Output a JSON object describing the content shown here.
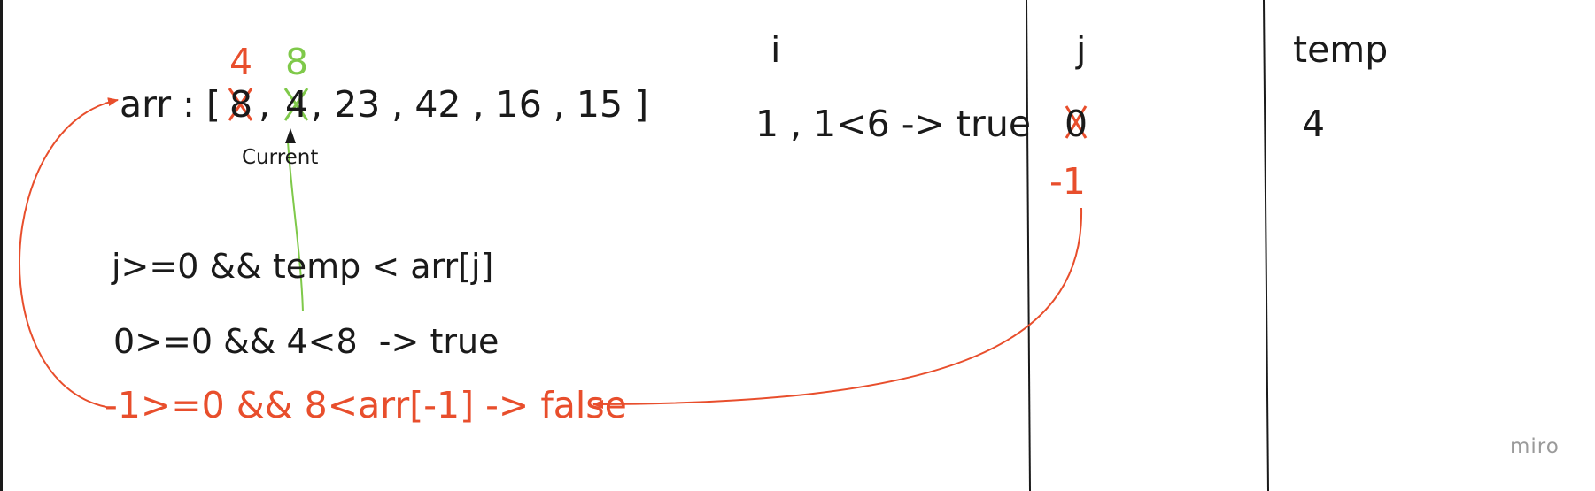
{
  "watermark": "miro",
  "headers": {
    "i": "i",
    "j": "j",
    "temp": "temp"
  },
  "array": {
    "prefix": "arr : [",
    "item1_old": "8",
    "item1_new": "4",
    "sep1": ",",
    "item2_old": "4",
    "item2_new": "8",
    "rest": ", 23 , 42 , 16 , 15 ]",
    "pointer_label": "Current"
  },
  "i_value": "1 , 1<6 -> true",
  "j_values": {
    "old": "0",
    "new": "-1"
  },
  "temp_value": "4",
  "conditions": {
    "general": "j>=0 && temp < arr[j]",
    "first": "0>=0 && 4<8  -> true",
    "second": "-1>=0 && 8<arr[-1] -> false"
  },
  "colors": {
    "accent_red": "#e84e2c",
    "accent_green": "#7fc94a",
    "ink": "#1a1a1a"
  }
}
